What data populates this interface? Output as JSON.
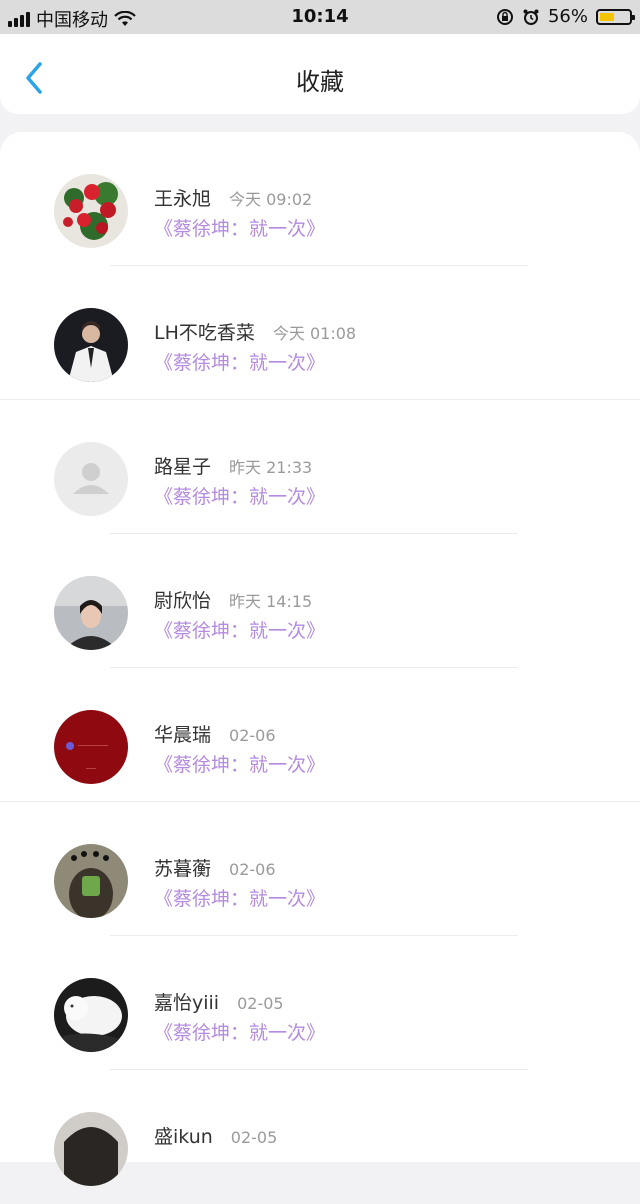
{
  "status_bar": {
    "carrier": "中国移动",
    "time": "10:14",
    "battery": "56%",
    "battery_level": 0.56,
    "battery_color": "#f5c400",
    "icons": [
      "signal-icon",
      "wifi-icon",
      "rotation-lock-icon",
      "alarm-icon",
      "battery-icon"
    ]
  },
  "nav": {
    "title": "收藏",
    "back_icon": "chevron-left-icon",
    "accent_color": "#2aa4e8"
  },
  "items": [
    {
      "name": "王永旭",
      "time": "今天 09:02",
      "song": "《蔡徐坤：就一次》",
      "avatar": "red-flowers"
    },
    {
      "name": "LH不吃香菜",
      "time": "今天 01:08",
      "song": "《蔡徐坤：就一次》",
      "avatar": "person-white-suit"
    },
    {
      "name": "路星子",
      "time": "昨天 21:33",
      "song": "《蔡徐坤：就一次》",
      "avatar": "default-avatar"
    },
    {
      "name": "尉欣怡",
      "time": "昨天 14:15",
      "song": "《蔡徐坤：就一次》",
      "avatar": "selfie-woman"
    },
    {
      "name": "华晨瑞",
      "time": "02-06",
      "song": "《蔡徐坤：就一次》",
      "avatar": "dark-red"
    },
    {
      "name": "苏暮蘅",
      "time": "02-06",
      "song": "《蔡徐坤：就一次》",
      "avatar": "mirror-selfie"
    },
    {
      "name": "嘉怡yiii",
      "time": "02-05",
      "song": "《蔡徐坤：就一次》",
      "avatar": "white-cat"
    },
    {
      "name": "盛ikun",
      "time": "02-05",
      "song": "",
      "avatar": "partial"
    }
  ]
}
